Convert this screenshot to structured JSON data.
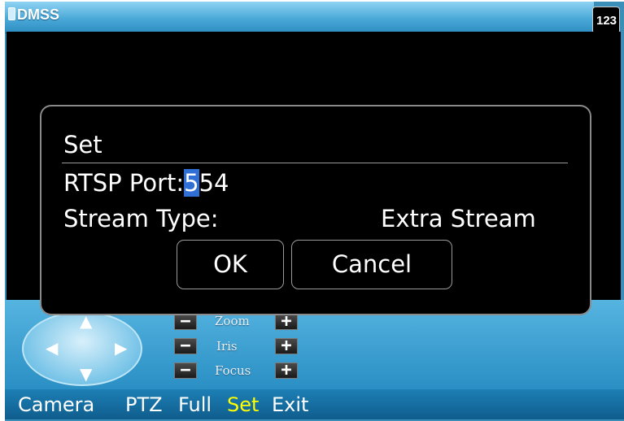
{
  "app": {
    "title": "DMSS",
    "input_mode": "123"
  },
  "ptz": {
    "controls": [
      {
        "label": "Zoom",
        "minus": "−",
        "plus": "+"
      },
      {
        "label": "Iris",
        "minus": "−",
        "plus": "+"
      },
      {
        "label": "Focus",
        "minus": "−",
        "plus": "+"
      }
    ]
  },
  "menu": {
    "items": [
      "Camera",
      "PTZ",
      "Full",
      "Set",
      "Exit"
    ],
    "active": "Set"
  },
  "dialog": {
    "title": "Set",
    "rtsp_port_label": "RTSP Port:",
    "rtsp_port_cursor": "5",
    "rtsp_port_rest": "54",
    "stream_type_label": "Stream Type:",
    "stream_type_value": "Extra Stream",
    "ok_label": "OK",
    "cancel_label": "Cancel"
  },
  "colors": {
    "active_menu": "#ffff00",
    "cursor_highlight": "#2f6fd6"
  }
}
